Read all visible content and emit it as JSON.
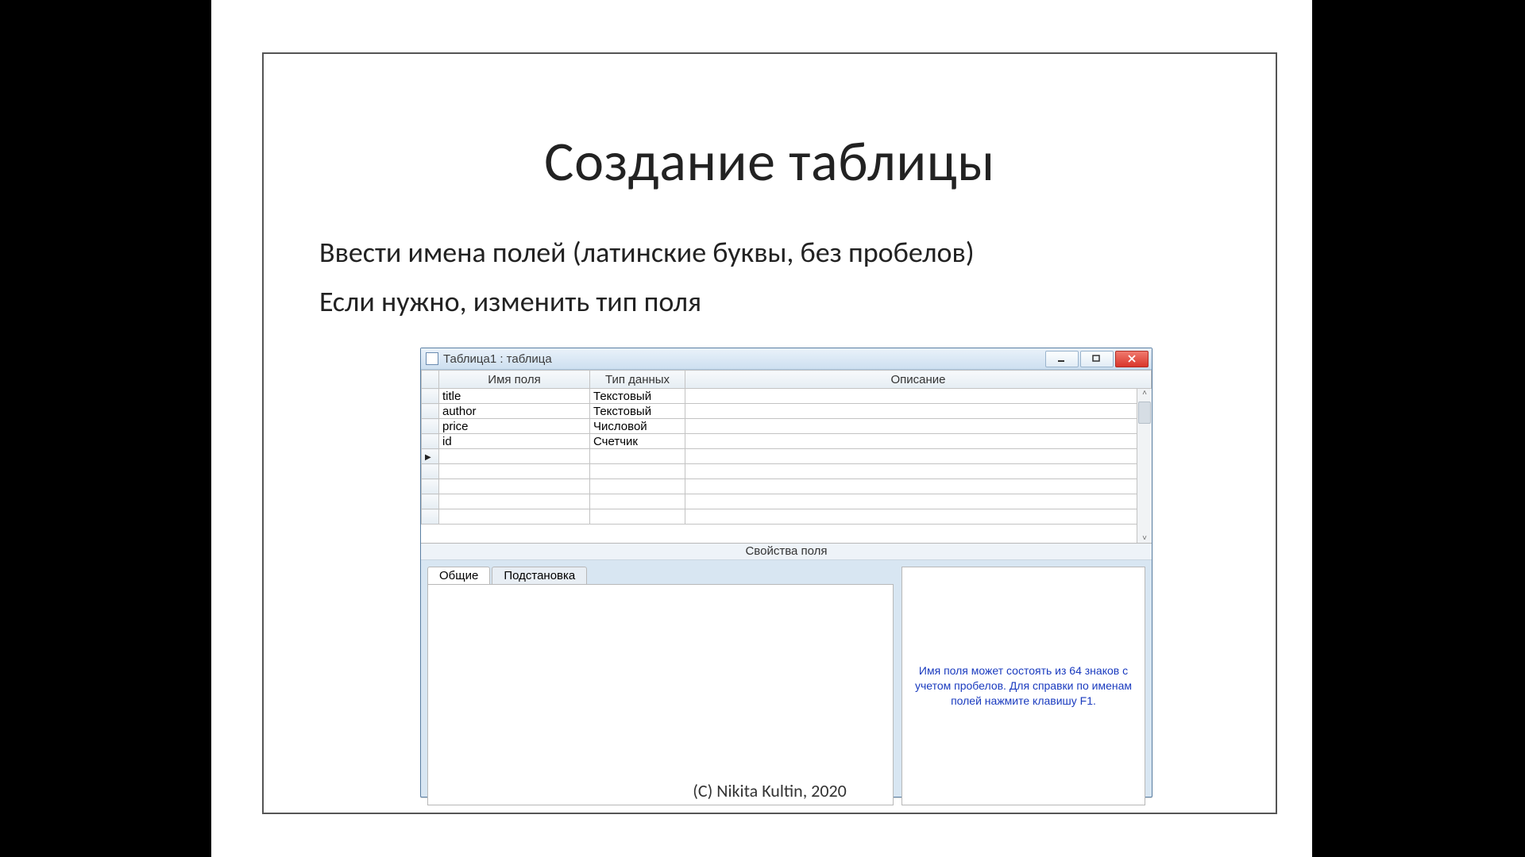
{
  "slide": {
    "title": "Создание таблицы",
    "line1": "Ввести имена полей (латинские буквы, без пробелов)",
    "line2": "Если нужно, изменить тип поля",
    "footer": "(C) Nikita Kultin, 2020"
  },
  "window": {
    "title": "Таблица1 : таблица",
    "columns": {
      "name": "Имя поля",
      "type": "Тип данных",
      "desc": "Описание"
    },
    "rows": [
      {
        "name": "title",
        "type": "Текстовый",
        "desc": ""
      },
      {
        "name": "author",
        "type": "Текстовый",
        "desc": ""
      },
      {
        "name": "price",
        "type": "Числовой",
        "desc": ""
      },
      {
        "name": "id",
        "type": "Счетчик",
        "desc": ""
      }
    ],
    "props_caption": "Свойства поля",
    "tabs": {
      "general": "Общие",
      "lookup": "Подстановка"
    },
    "hint": "Имя поля может состоять из 64 знаков с учетом пробелов.  Для справки по именам полей нажмите клавишу F1."
  }
}
